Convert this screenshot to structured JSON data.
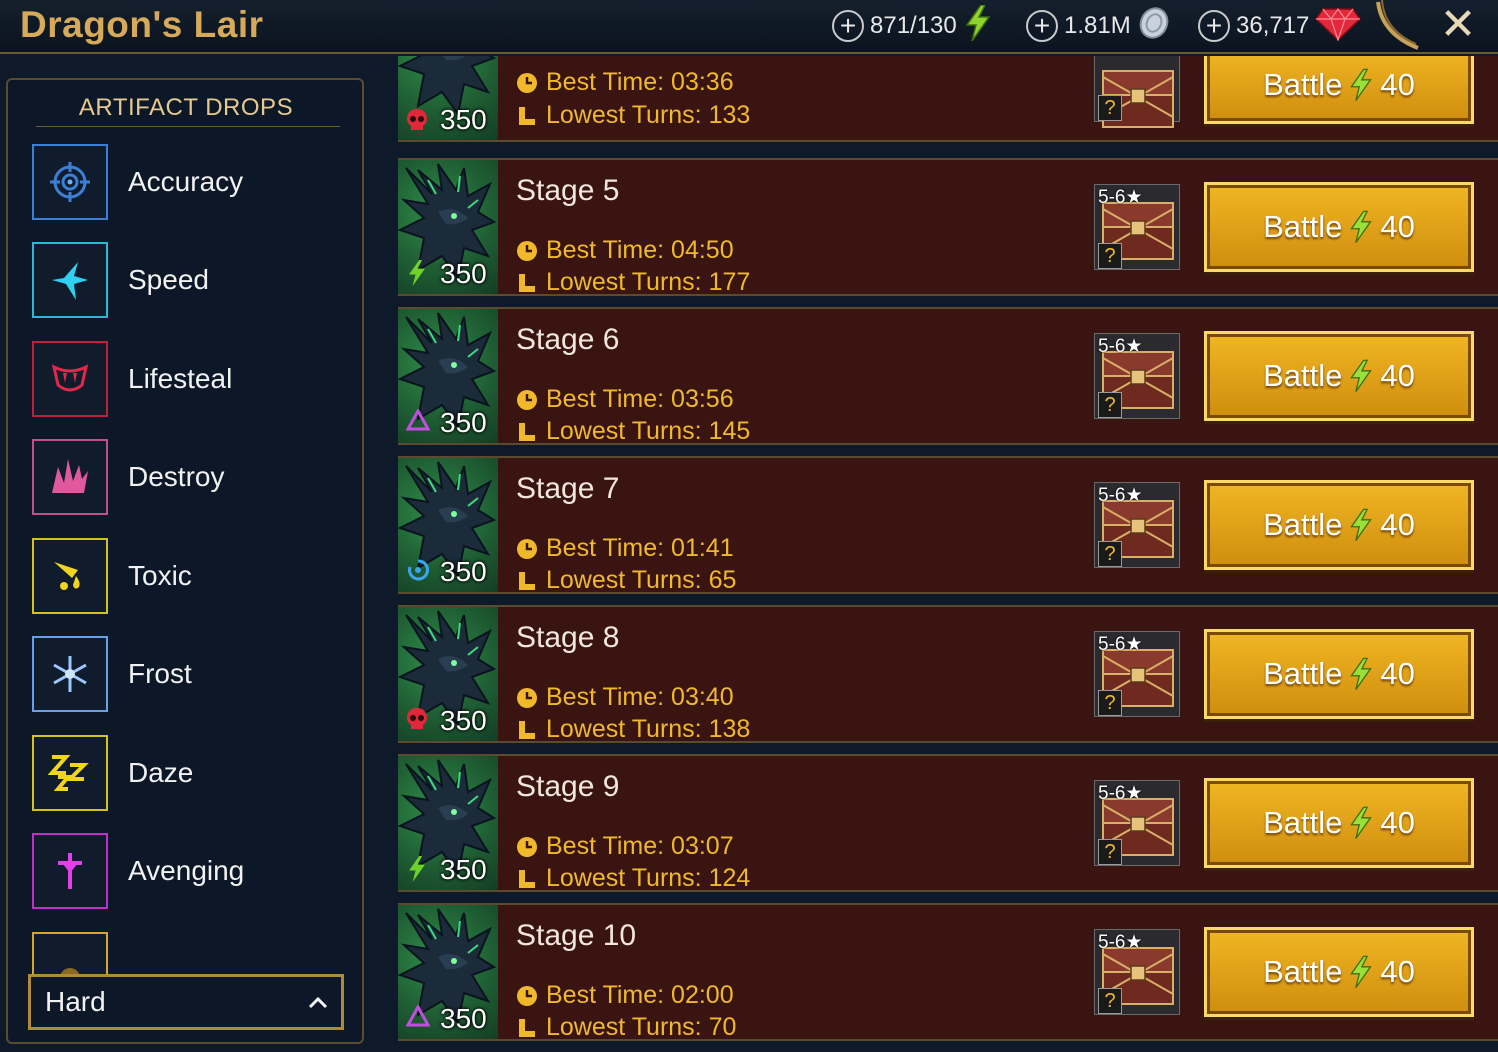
{
  "header": {
    "title": "Dragon's Lair",
    "energy": "871/130",
    "silver": "1.81M",
    "gems": "36,717"
  },
  "sidebar": {
    "heading": "ARTIFACT DROPS",
    "items": [
      {
        "label": "Accuracy",
        "color": "#3b7fd6"
      },
      {
        "label": "Speed",
        "color": "#2fb7d8"
      },
      {
        "label": "Lifesteal",
        "color": "#c01e3c"
      },
      {
        "label": "Destroy",
        "color": "#c04f8a"
      },
      {
        "label": "Toxic",
        "color": "#d6c21e"
      },
      {
        "label": "Frost",
        "color": "#6aa0e8"
      },
      {
        "label": "Daze",
        "color": "#d6c21e"
      },
      {
        "label": "Avenging",
        "color": "#c22ec9"
      }
    ],
    "difficulty": "Hard"
  },
  "stages": [
    {
      "name": "",
      "best_time": "Best Time: 03:36",
      "lowest_turns": "Lowest Turns: 133",
      "power": "350",
      "difficulty_icon": "skull-icon",
      "rank": "",
      "battle_label": "Battle",
      "battle_cost": "40"
    },
    {
      "name": "Stage 5",
      "best_time": "Best Time: 04:50",
      "lowest_turns": "Lowest Turns: 177",
      "power": "350",
      "difficulty_icon": "bolt-icon",
      "rank": "5-6",
      "battle_label": "Battle",
      "battle_cost": "40"
    },
    {
      "name": "Stage 6",
      "best_time": "Best Time: 03:56",
      "lowest_turns": "Lowest Turns: 145",
      "power": "350",
      "difficulty_icon": "triangle-icon",
      "rank": "5-6",
      "battle_label": "Battle",
      "battle_cost": "40"
    },
    {
      "name": "Stage 7",
      "best_time": "Best Time: 01:41",
      "lowest_turns": "Lowest Turns: 65",
      "power": "350",
      "difficulty_icon": "swirl-icon",
      "rank": "5-6",
      "battle_label": "Battle",
      "battle_cost": "40"
    },
    {
      "name": "Stage 8",
      "best_time": "Best Time: 03:40",
      "lowest_turns": "Lowest Turns: 138",
      "power": "350",
      "difficulty_icon": "skull-icon",
      "rank": "5-6",
      "battle_label": "Battle",
      "battle_cost": "40"
    },
    {
      "name": "Stage 9",
      "best_time": "Best Time: 03:07",
      "lowest_turns": "Lowest Turns: 124",
      "power": "350",
      "difficulty_icon": "bolt-icon",
      "rank": "5-6",
      "battle_label": "Battle",
      "battle_cost": "40"
    },
    {
      "name": "Stage 10",
      "best_time": "Best Time: 02:00",
      "lowest_turns": "Lowest Turns: 70",
      "power": "350",
      "difficulty_icon": "triangle-icon",
      "rank": "5-6",
      "battle_label": "Battle",
      "battle_cost": "40"
    }
  ]
}
